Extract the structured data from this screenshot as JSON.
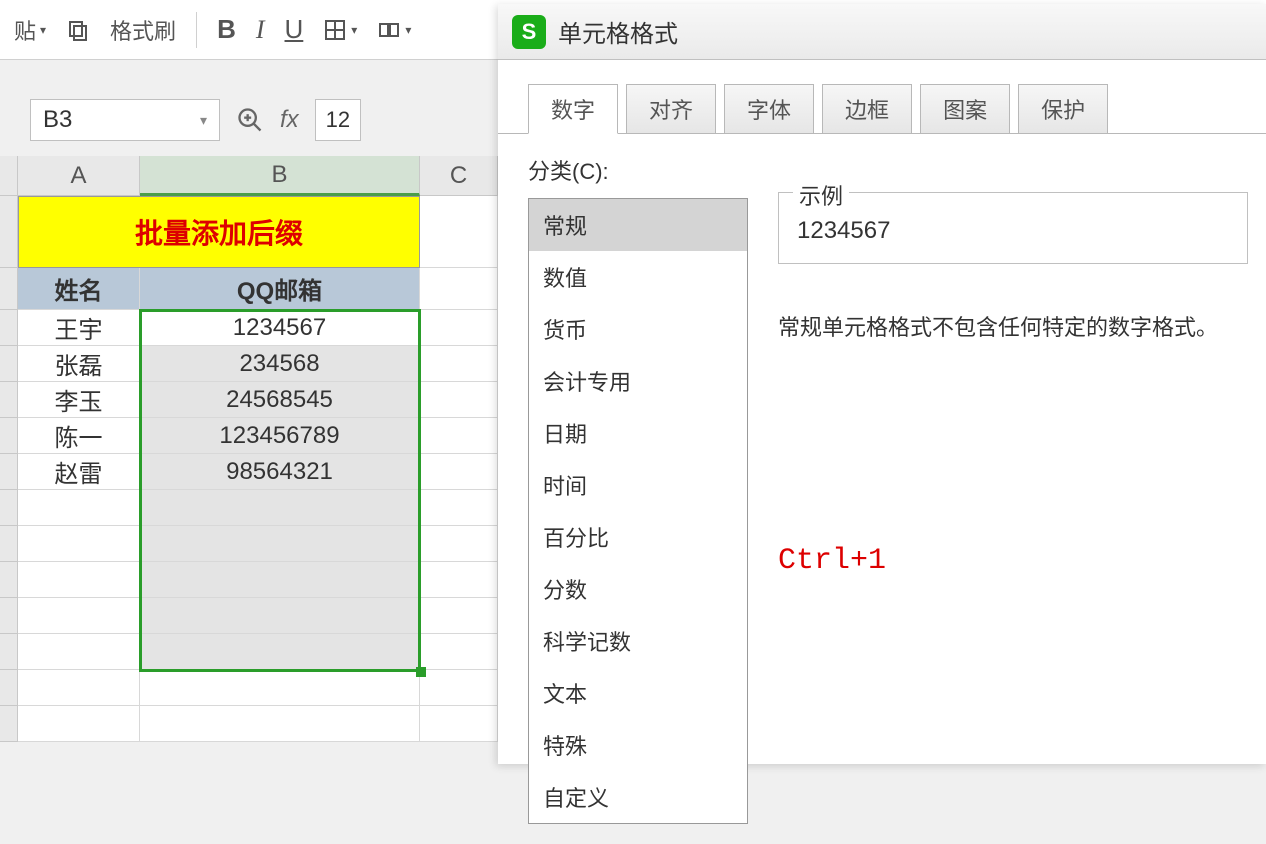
{
  "toolbar": {
    "paste_label": "贴",
    "format_brush": "格式刷",
    "bold": "B",
    "italic": "I",
    "underline": "U"
  },
  "name_box": "B3",
  "formula_fragment": "12",
  "fx_label": "fx",
  "columns": [
    "A",
    "B",
    "C"
  ],
  "sheet": {
    "title": "批量添加后缀",
    "header_a": "姓名",
    "header_b": "QQ邮箱",
    "rows": [
      {
        "name": "王宇",
        "qq": "1234567"
      },
      {
        "name": "张磊",
        "qq": "234568"
      },
      {
        "name": "李玉",
        "qq": "24568545"
      },
      {
        "name": "陈一",
        "qq": "123456789"
      },
      {
        "name": "赵雷",
        "qq": "98564321"
      }
    ]
  },
  "dialog": {
    "title": "单元格格式",
    "tabs": [
      "数字",
      "对齐",
      "字体",
      "边框",
      "图案",
      "保护"
    ],
    "active_tab": 0,
    "category_label": "分类(C):",
    "categories": [
      "常规",
      "数值",
      "货币",
      "会计专用",
      "日期",
      "时间",
      "百分比",
      "分数",
      "科学记数",
      "文本",
      "特殊",
      "自定义"
    ],
    "selected_category": 0,
    "example_label": "示例",
    "example_value": "1234567",
    "description": "常规单元格格式不包含任何特定的数字格式。",
    "shortcut_hint": "Ctrl+1"
  }
}
